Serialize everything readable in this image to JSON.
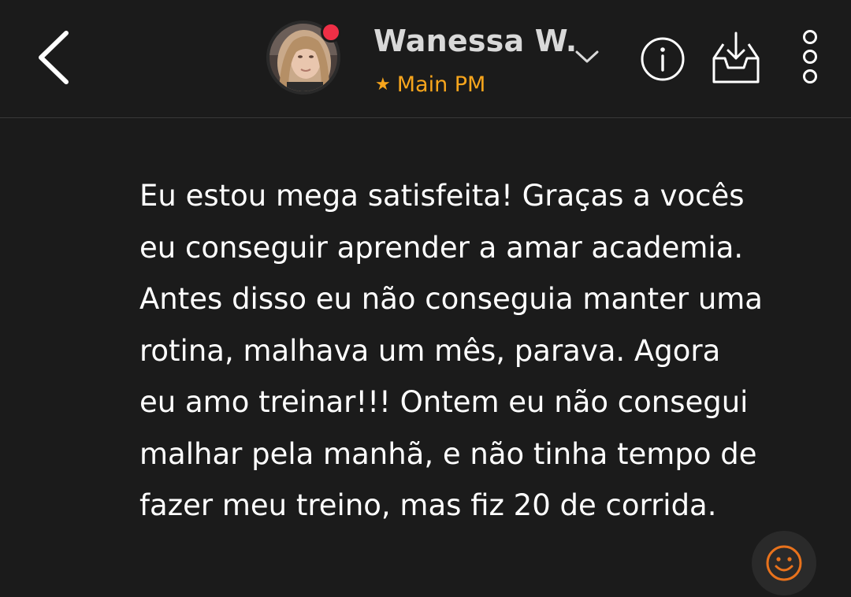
{
  "header": {
    "back_icon": "chevron-left-icon",
    "user_name": "Wanessa W.",
    "subtitle_icon": "star-icon",
    "subtitle": "Main PM",
    "online_status_color": "#ef2f46",
    "accent_color": "#f7a51c",
    "actions": [
      {
        "icon": "info-icon"
      },
      {
        "icon": "inbox-download-icon"
      },
      {
        "icon": "more-vertical-icon"
      }
    ]
  },
  "message": {
    "text": "Eu estou mega satisfeita! Graças a vocês\neu conseguir aprender a amar academia.\nAntes disso eu não conseguia manter uma\nrotina, malhava um mês, parava. Agora\neu amo treinar!!! Ontem eu não consegui\nmalhar pela manhã, e não tinha tempo de\nfazer meu treino, mas fiz 20 de corrida."
  },
  "reaction": {
    "icon": "smiley-icon",
    "color": "#e8721c"
  }
}
